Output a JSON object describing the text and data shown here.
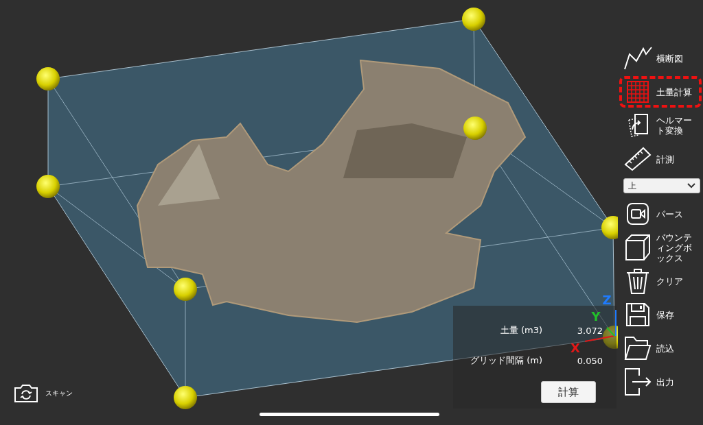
{
  "axes": [
    {
      "label": "Z",
      "color": "#1e7bff"
    },
    {
      "label": "Y",
      "color": "#22c02a"
    },
    {
      "label": "X",
      "color": "#e01818"
    }
  ],
  "scan_button": {
    "label": "スキャン"
  },
  "volume_panel": {
    "rows": [
      {
        "label": "土量 (m3)",
        "value": "3.072"
      },
      {
        "label": "グリッド間隔 (m)",
        "value": "0.050"
      }
    ],
    "button": "計算"
  },
  "tools": [
    {
      "kind": "button",
      "label": "横断図",
      "selected": false
    },
    {
      "kind": "button",
      "label": "土量計算",
      "selected": true
    },
    {
      "kind": "button",
      "label": "ヘルマート変換",
      "selected": false
    },
    {
      "kind": "button",
      "label": "計測",
      "selected": false
    },
    {
      "kind": "dropdown",
      "value": "上"
    },
    {
      "kind": "button",
      "label": "パース",
      "selected": false
    },
    {
      "kind": "button",
      "label": "バウンティングボックス",
      "selected": false
    },
    {
      "kind": "button",
      "label": "クリア",
      "selected": false
    },
    {
      "kind": "button",
      "label": "保存",
      "selected": false
    },
    {
      "kind": "button",
      "label": "読込",
      "selected": false
    },
    {
      "kind": "button",
      "label": "出力",
      "selected": false
    }
  ]
}
